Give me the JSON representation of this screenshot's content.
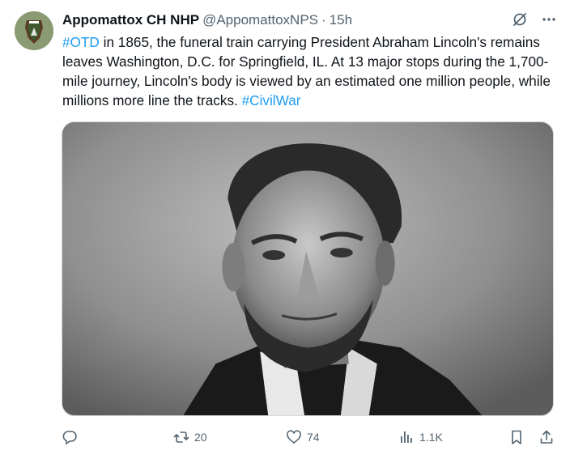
{
  "account": {
    "name": "Appomattox CH NHP",
    "handle": "@AppomattoxNPS",
    "separator": "·",
    "time": "15h"
  },
  "tweet": {
    "hashtag_1": "#OTD",
    "body": " in 1865, the funeral train carrying President Abraham Lincoln's remains leaves Washington, D.C. for Springfield, IL. At 13 major stops during the 1,700-mile journey, Lincoln's body is viewed by an estimated one million people, while millions more line the tracks. ",
    "hashtag_2": "#CivilWar"
  },
  "media": {
    "icon": "lincoln-portrait-photo"
  },
  "actions": {
    "replies": "",
    "reposts": "20",
    "likes": "74",
    "views": "1.1K"
  },
  "colors": {
    "link": "#1d9bf0",
    "secondary": "#536471",
    "border": "#cfd9de"
  }
}
